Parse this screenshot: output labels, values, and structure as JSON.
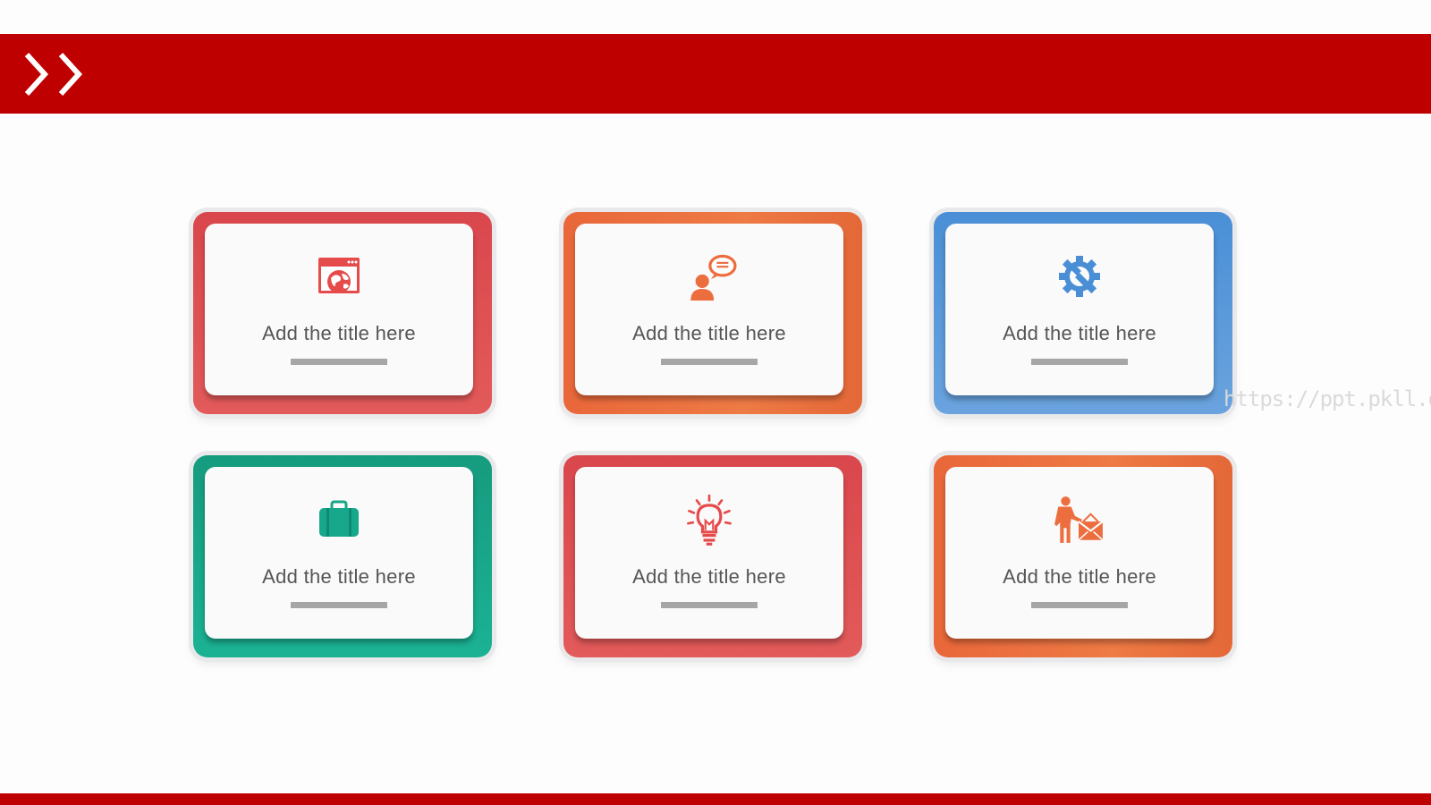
{
  "header": {
    "color": "#bf0000",
    "decor_icon": "double-chevron-right-icon"
  },
  "cards": [
    {
      "title": "Add the title here",
      "color": "#e05053",
      "icon": "web-browser-globe-icon"
    },
    {
      "title": "Add the title here",
      "color": "#ec6e3f",
      "icon": "person-speech-bubble-icon"
    },
    {
      "title": "Add the title here",
      "color": "#5596da",
      "icon": "gear-wrench-icon"
    },
    {
      "title": "Add the title here",
      "color": "#17a78a",
      "icon": "briefcase-icon"
    },
    {
      "title": "Add the title here",
      "color": "#e05053",
      "icon": "lightbulb-icon"
    },
    {
      "title": "Add the title here",
      "color": "#ec6e3f",
      "icon": "worker-envelope-icon"
    }
  ],
  "watermark": "https://ppt.pkll.de",
  "footer": {
    "color": "#bf0000"
  }
}
